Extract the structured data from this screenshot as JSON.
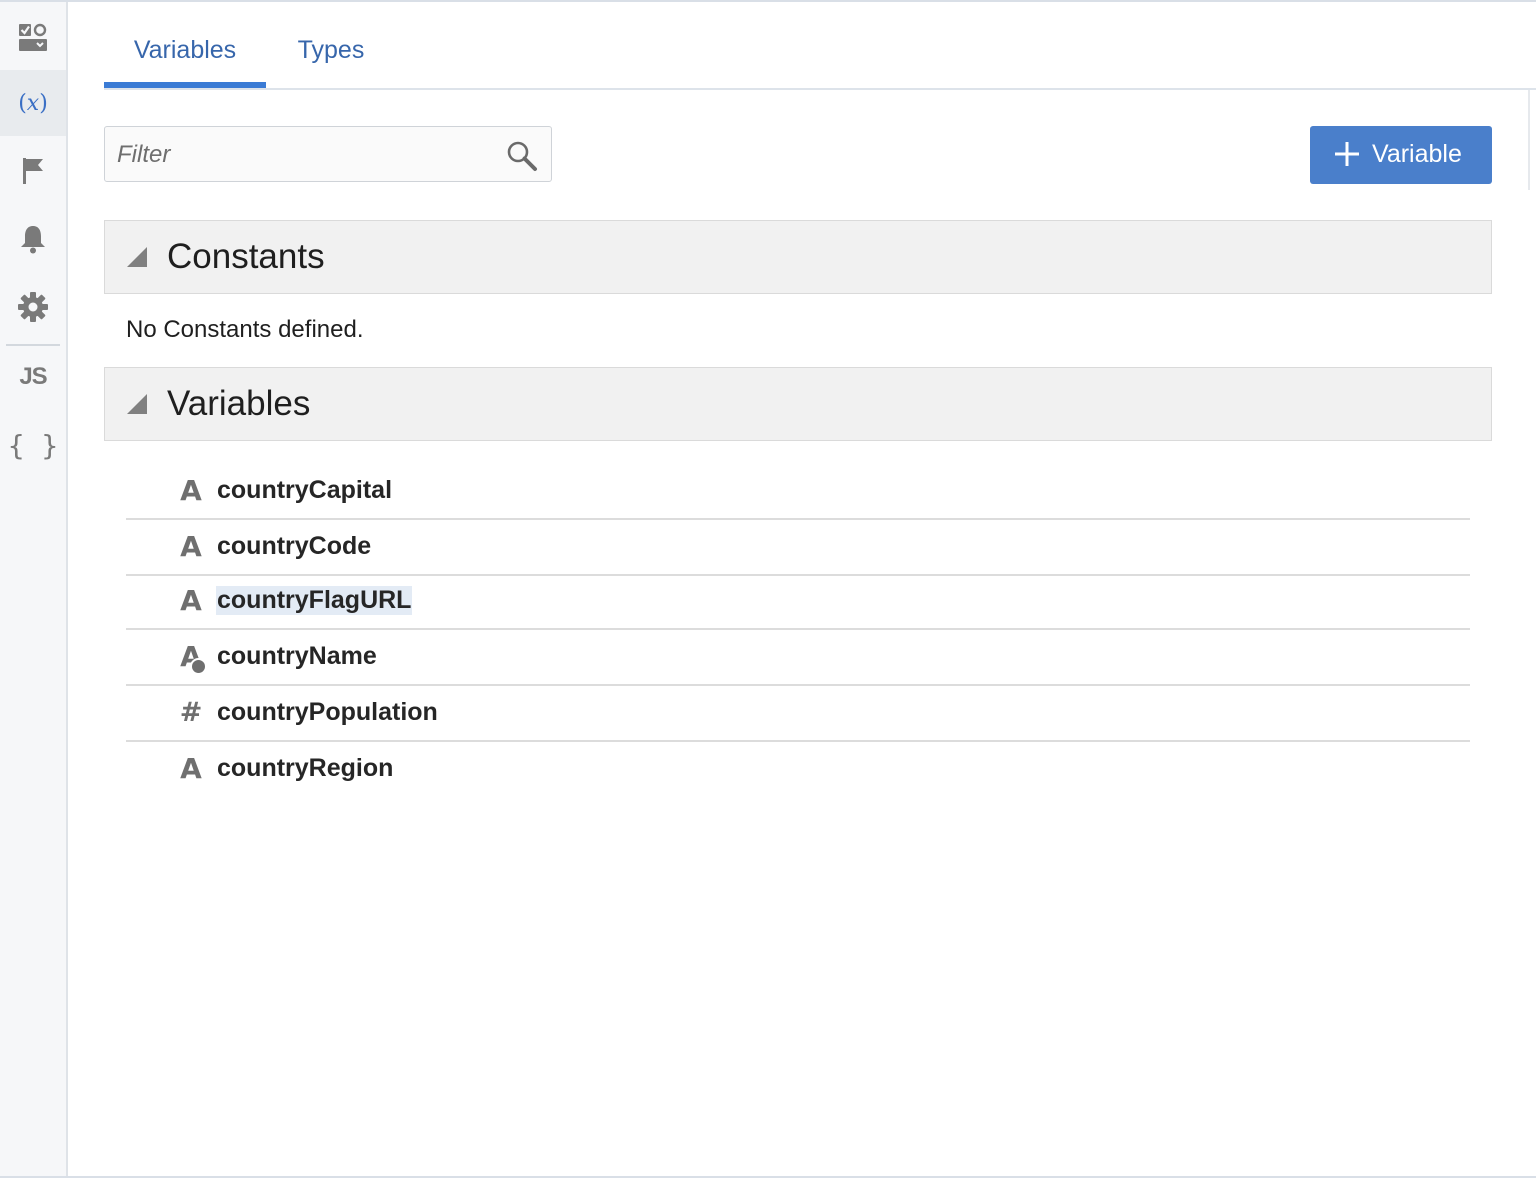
{
  "sidebar": {
    "items": [
      {
        "id": "overview",
        "icon": "checklist-icon"
      },
      {
        "id": "variables",
        "icon": "variable-x-icon",
        "label": "(x)",
        "active": true
      },
      {
        "id": "events",
        "icon": "flag-icon"
      },
      {
        "id": "notifications",
        "icon": "bell-icon"
      },
      {
        "id": "settings",
        "icon": "gear-icon"
      },
      {
        "id": "javascript",
        "icon": "js-icon",
        "label": "JS"
      },
      {
        "id": "json",
        "icon": "braces-icon",
        "label": "{ }"
      }
    ]
  },
  "tabs": [
    {
      "label": "Variables",
      "selected": true
    },
    {
      "label": "Types",
      "selected": false
    }
  ],
  "filter": {
    "placeholder": "Filter",
    "value": ""
  },
  "add_button": {
    "label": "Variable",
    "icon": "plus-icon"
  },
  "constants": {
    "title": "Constants",
    "empty_message": "No Constants defined."
  },
  "variables": {
    "title": "Variables",
    "items": [
      {
        "name": "countryCapital",
        "type_icon": "string-icon"
      },
      {
        "name": "countryCode",
        "type_icon": "string-icon"
      },
      {
        "name": "countryFlagURL",
        "type_icon": "string-icon",
        "highlighted": true
      },
      {
        "name": "countryName",
        "type_icon": "string-input-icon"
      },
      {
        "name": "countryPopulation",
        "type_icon": "number-icon"
      },
      {
        "name": "countryRegion",
        "type_icon": "string-icon"
      }
    ]
  },
  "colors": {
    "accent": "#3a7bd5",
    "button": "#4a7fcb",
    "tab_text": "#3766ab",
    "section_bg": "#f1f1f1"
  }
}
